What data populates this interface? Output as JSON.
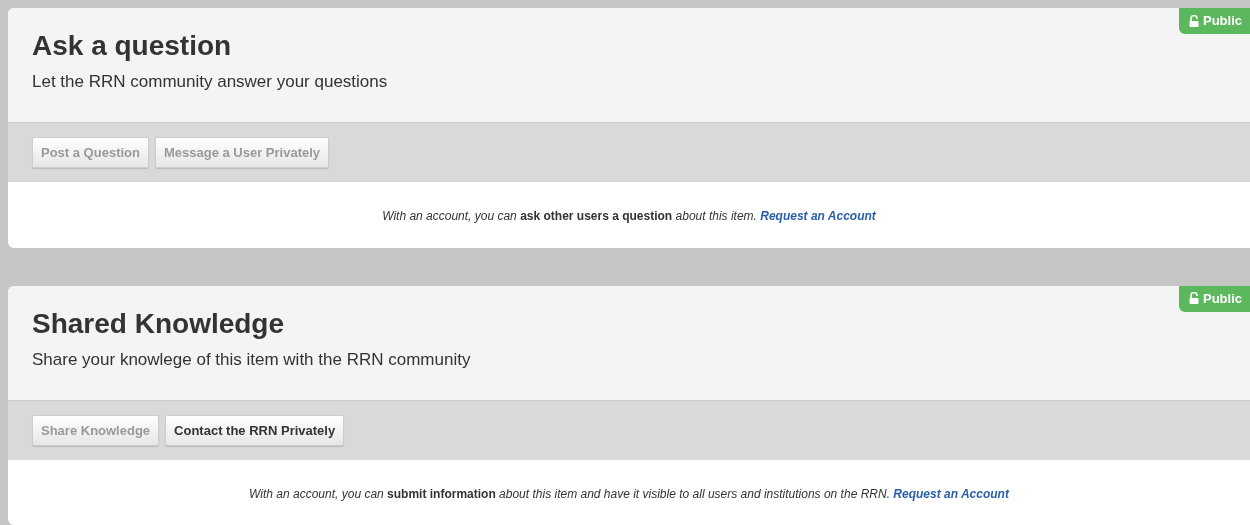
{
  "panels": [
    {
      "title": "Ask a question",
      "subtitle": "Let the RRN community answer your questions",
      "badge": "Public",
      "buttons": [
        {
          "label": "Post a Question",
          "disabled": true
        },
        {
          "label": "Message a User Privately",
          "disabled": true
        }
      ],
      "notice": "*With an account, you can* **ask other users a question** *about this item.*",
      "link": "Request an Account"
    },
    {
      "title": "Shared Knowledge",
      "subtitle": "Share your knowlege of this item with the RRN community",
      "badge": "Public",
      "buttons": [
        {
          "label": "Share Knowledge",
          "disabled": true
        },
        {
          "label": "Contact the RRN Privately",
          "disabled": false
        }
      ],
      "notice": "*With an account, you can* **submit information** *about this item and have it visible to all users and institutions on the RRN.*",
      "link": "Request an Account"
    }
  ]
}
